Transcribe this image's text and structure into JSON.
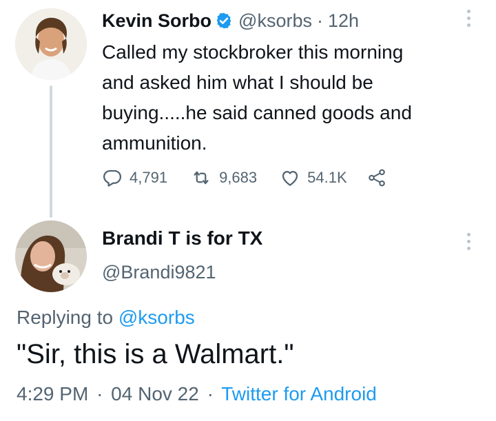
{
  "tweet": {
    "author_name": "Kevin Sorbo",
    "handle": "@ksorbs",
    "separator": "·",
    "time_ago": "12h",
    "text_lines": [
      "Called my stockbroker this morning",
      "and asked him what I should be",
      "buying.....he said canned goods and",
      "ammunition."
    ],
    "replies": "4,791",
    "retweets": "9,683",
    "likes": "54.1K"
  },
  "reply": {
    "author_name": "Brandi T is for TX",
    "handle": "@Brandi9821",
    "replying_prefix": "Replying to",
    "replying_to": "@ksorbs",
    "text": "\"Sir, this is a Walmart.\"",
    "time": "4:29 PM",
    "sep1": "·",
    "date": "04 Nov 22",
    "sep2": "·",
    "source": "Twitter for Android"
  },
  "colors": {
    "accent": "#1d9bf0",
    "muted": "#536471",
    "verified": "#1d9bf0",
    "thread_line": "#cfd9de"
  },
  "icons": [
    "verified-badge-icon",
    "more-icon",
    "reply-icon",
    "retweet-icon",
    "like-icon",
    "share-icon"
  ]
}
